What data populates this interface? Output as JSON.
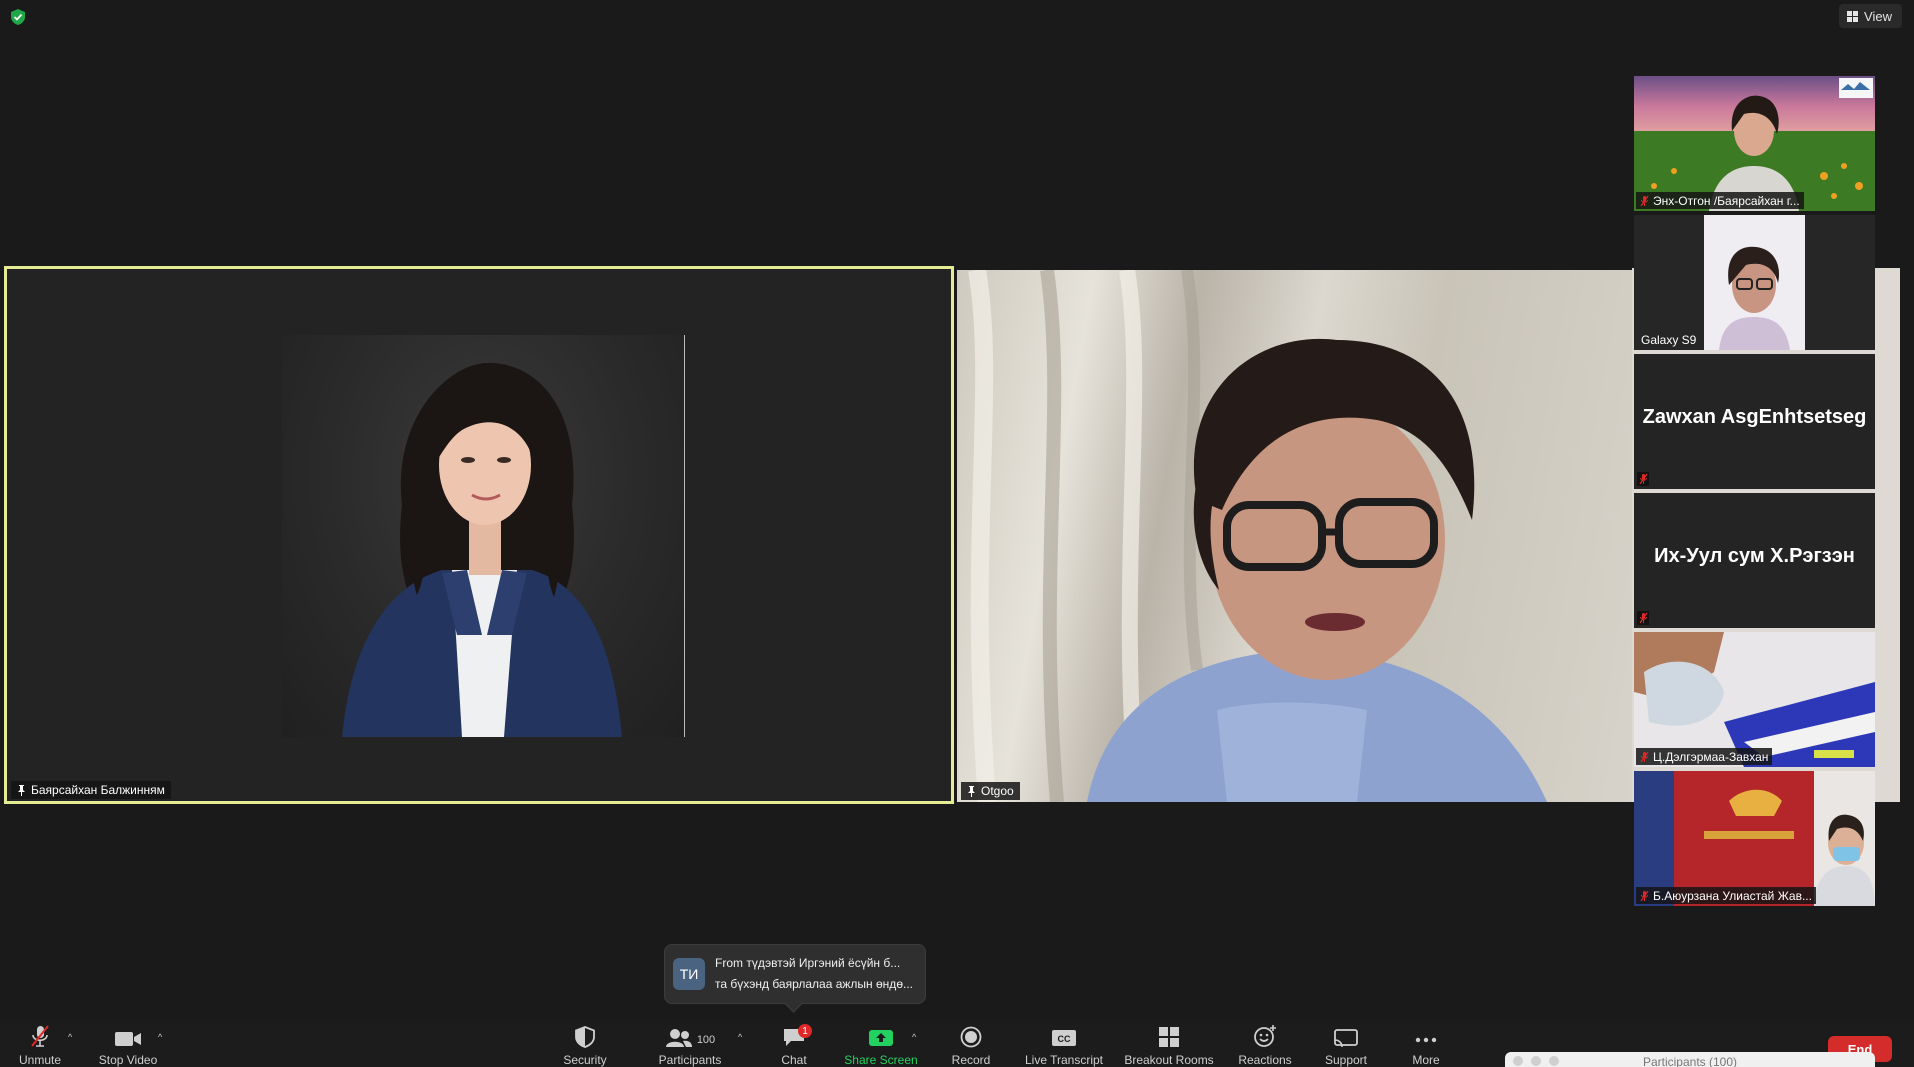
{
  "topbar": {
    "view_label": "View"
  },
  "main": {
    "left": {
      "name": "Баярсайхан Балжинням"
    },
    "right": {
      "name": "Otgoo"
    }
  },
  "sidebar": {
    "tiles": [
      {
        "name": "Энх-Отгон /Баярсайхан г...",
        "type": "video",
        "muted": true
      },
      {
        "name": "Galaxy S9",
        "type": "video",
        "muted": false
      },
      {
        "name": "Zawxan AsgEnhtsetseg",
        "type": "avatar",
        "muted": true
      },
      {
        "name": "Их-Уул сум Х.Рэгзэн",
        "type": "avatar",
        "muted": true
      },
      {
        "name": "Ц.Дэлгэрмаа-Завхан",
        "type": "video",
        "muted": true
      },
      {
        "name": "Б.Аюурзана Улиастай Жав...",
        "type": "video",
        "muted": true
      }
    ]
  },
  "toast": {
    "avatar_initials": "ТИ",
    "line1": "From түдэвтэй Иргэний ёсүйн б...",
    "line2": "та бүхэнд баярлалаа ажлын өндө..."
  },
  "toolbar": {
    "unmute": "Unmute",
    "stop_video": "Stop Video",
    "security": "Security",
    "participants": "Participants",
    "participants_count": "100",
    "chat": "Chat",
    "chat_badge": "1",
    "share_screen": "Share Screen",
    "record": "Record",
    "live_transcript": "Live Transcript",
    "breakout_rooms": "Breakout Rooms",
    "reactions": "Reactions",
    "support": "Support",
    "more": "More",
    "end": "End"
  },
  "participants_panel": {
    "title": "Participants (100)"
  },
  "colors": {
    "active_speaker_border": "#e6ec94",
    "share_screen_green": "#23d160",
    "end_red": "#d42b2b",
    "muted_red": "#e02828"
  }
}
